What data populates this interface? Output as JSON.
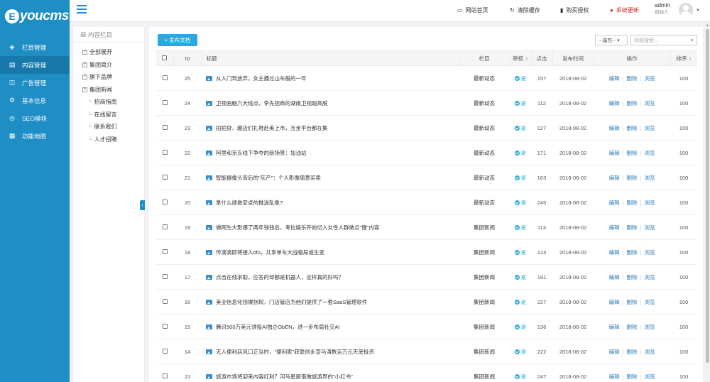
{
  "brand": {
    "logo_letter": "E",
    "logo_text": "youcms"
  },
  "sidebar": {
    "items": [
      {
        "label": "栏目管理",
        "icon": "layers-icon",
        "glyph": "◈"
      },
      {
        "label": "内容管理",
        "icon": "document-icon",
        "glyph": "▤"
      },
      {
        "label": "广告管理",
        "icon": "ad-icon",
        "glyph": "◫"
      },
      {
        "label": "基本信息",
        "icon": "gear-icon",
        "glyph": "⚙"
      },
      {
        "label": "SEO模块",
        "icon": "seo-icon",
        "glyph": "◎"
      },
      {
        "label": "功能地图",
        "icon": "grid-icon",
        "glyph": "▦"
      }
    ],
    "active_index": 1
  },
  "topbar": {
    "links": [
      {
        "label": "网站首页",
        "glyph": "▭"
      },
      {
        "label": "清除缓存",
        "glyph": "↻"
      },
      {
        "label": "购买授权",
        "glyph": "▮"
      },
      {
        "label": "系统更新",
        "glyph": "●"
      }
    ],
    "user_name": "admin",
    "user_role": "创始人"
  },
  "column_panel": {
    "title": "内容栏目",
    "tree": [
      {
        "label": "全部展开",
        "type": "toggle"
      },
      {
        "label": "集团简介",
        "type": "toggle"
      },
      {
        "label": "旗下品牌",
        "type": "toggle"
      },
      {
        "label": "集团新闻",
        "type": "toggle"
      },
      {
        "label": "招商指南",
        "type": "leaf"
      },
      {
        "label": "在线留言",
        "type": "leaf"
      },
      {
        "label": "联系我们",
        "type": "leaf"
      },
      {
        "label": "人才招聘",
        "type": "leaf"
      }
    ]
  },
  "toolbar": {
    "add_label": "+ 发布文档",
    "attr_select": "--属性-- ▾",
    "search_placeholder": "标题搜索..."
  },
  "table": {
    "headers": {
      "id": "ID",
      "title": "标题",
      "column": "栏目",
      "audit": "审核",
      "clicks": "点击",
      "pubtime": "发布时间",
      "ops": "操作",
      "sort": "排序"
    },
    "op_labels": {
      "edit": "编辑",
      "delete": "删除",
      "view": "浏览"
    },
    "audit_yes": "是",
    "rows": [
      {
        "id": "25",
        "title": "从入门到放弃，女主播过山车般的一年",
        "column": "最新动态",
        "clicks": "157",
        "date": "2018-08-02",
        "sort": "100"
      },
      {
        "id": "24",
        "title": "卫视画脑六大线点，李先招商的湖南卫视超高脱",
        "column": "最新动态",
        "clicks": "112",
        "date": "2018-08-02",
        "sort": "100"
      },
      {
        "id": "23",
        "title": "拍拍贷、趣店们扎堆赴美上市，互金平台都在集",
        "column": "最新动态",
        "clicks": "127",
        "date": "2018-08-02",
        "sort": "100"
      },
      {
        "id": "22",
        "title": "阿里和京东线下争夺的新场景：加油站",
        "column": "最新动态",
        "clicks": "171",
        "date": "2018-08-02",
        "sort": "100"
      },
      {
        "id": "21",
        "title": "智能摄像头背后的\"灰产\"：个人影像随意买卖",
        "column": "最新动态",
        "clicks": "163",
        "date": "2018-08-02",
        "sort": "100"
      },
      {
        "id": "20",
        "title": "拿什么拯救安卓的推送乱象?",
        "column": "最新动态",
        "clicks": "245",
        "date": "2018-08-02",
        "sort": "100"
      },
      {
        "id": "19",
        "title": "做网生大影爆了两年钱钱后，考拉娱乐开始切入女性人群做点\"慢\"内容",
        "column": "集团新闻",
        "clicks": "113",
        "date": "2018-08-02",
        "sort": "100"
      },
      {
        "id": "18",
        "title": "传滴滴即将接入ofo，共享单车大战格局或生变",
        "column": "集团新闻",
        "clicks": "124",
        "date": "2018-08-02",
        "sort": "100"
      },
      {
        "id": "17",
        "title": "点击在线求助，应答的却都是机器人，这样真的好吗？",
        "column": "集团新闻",
        "clicks": "191",
        "date": "2018-08-02",
        "sort": "100"
      },
      {
        "id": "16",
        "title": "美业信息化拐爆拐现，门店管店为他们提供了一套SaaS管理软件",
        "column": "集团新闻",
        "clicks": "227",
        "date": "2018-08-02",
        "sort": "100"
      },
      {
        "id": "15",
        "title": "腾讯500万美元领投AI独企ObEN，进一步布局社交AI",
        "column": "集团新闻",
        "clicks": "136",
        "date": "2018-08-02",
        "sort": "100"
      },
      {
        "id": "14",
        "title": "无人便利店风口正当时，\"便利家\"获联创永宣马涛数百万元天使投资",
        "column": "集团新闻",
        "clicks": "222",
        "date": "2018-08-02",
        "sort": "100"
      },
      {
        "id": "13",
        "title": "旅游市场将迎来内容红利？河马星居借做旅游界的\"小红书\"",
        "column": "集团新闻",
        "clicks": "247",
        "date": "2018-08-02",
        "sort": "100"
      }
    ]
  },
  "colors": {
    "sidebar": "#1e8ec4",
    "accent": "#27a9e3",
    "link": "#2b7bb9",
    "alert": "#e02020"
  }
}
